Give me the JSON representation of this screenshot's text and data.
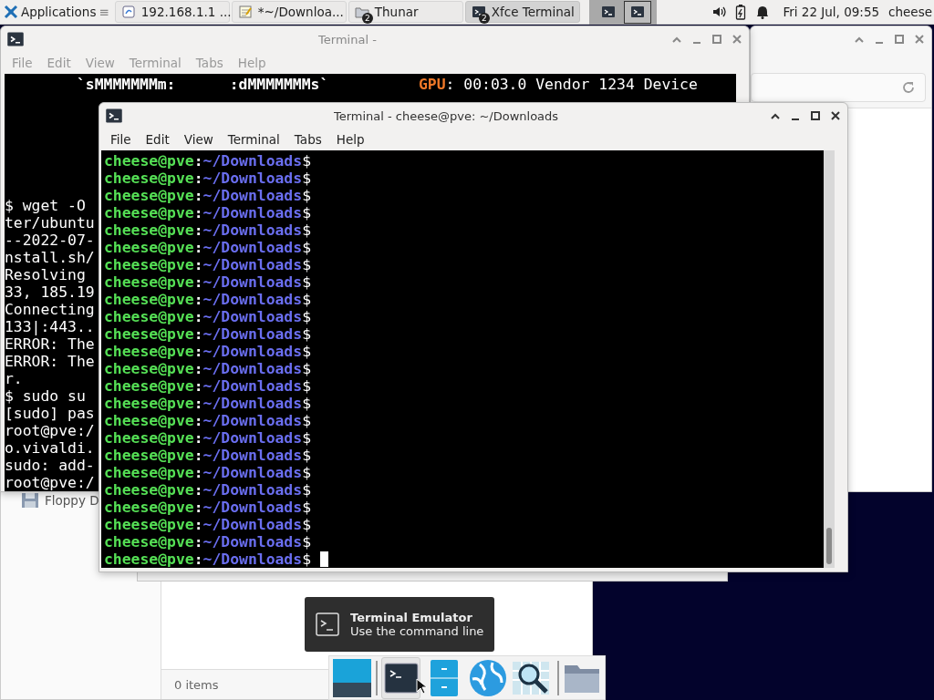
{
  "panel": {
    "apps_menu": "Applications",
    "apps_glyph": "≡",
    "tasks": [
      {
        "label": "192.168.1.1 ...",
        "kind": "browser",
        "selected": false
      },
      {
        "label": "*~/Downloa...",
        "kind": "editor",
        "selected": false
      },
      {
        "label": "Thunar",
        "kind": "files",
        "badge": "2",
        "selected": false
      },
      {
        "label": "Xfce Terminal",
        "kind": "terminal",
        "badge": "2",
        "selected": true
      }
    ],
    "workspaces": [
      {
        "selected": false
      },
      {
        "selected": true
      }
    ],
    "clock": "Fri 22 Jul, 09:55",
    "user": "cheese"
  },
  "back_terminal": {
    "title": "Terminal -",
    "menu": [
      "File",
      "Edit",
      "View",
      "Terminal",
      "Tabs",
      "Help"
    ],
    "info_lines": [
      {
        "art": "        `sMMMMMMMm:      :dMMMMMMMs`",
        "key": "GPU",
        "value": ": 00:03.0 Vendor 1234 Device"
      }
    ],
    "lines": [
      "$ wget -O",
      "ter/ubuntu",
      "--2022-07-",
      "nstall.sh/",
      "Resolving",
      "33, 185.19",
      "Connecting",
      "133|:443..",
      "ERROR: The",
      "ERROR: The",
      "r.",
      "$ sudo su",
      "[sudo] pas",
      "root@pve:/",
      "o.vivaldi.",
      "sudo: add-",
      "root@pve:/"
    ]
  },
  "file_manager": {
    "sidebar": [
      {
        "label": "Floppy D"
      }
    ],
    "status": "0 items"
  },
  "front_terminal": {
    "title": "Terminal - cheese@pve: ~/Downloads",
    "menu": [
      "File",
      "Edit",
      "View",
      "Terminal",
      "Tabs",
      "Help"
    ],
    "prompts": [
      {
        "user": "cheese@pve",
        "sep": ":",
        "path": "~/Downloads",
        "sign": "$",
        "cursor": false
      },
      {
        "user": "cheese@pve",
        "sep": ":",
        "path": "~/Downloads",
        "sign": "$",
        "cursor": false
      },
      {
        "user": "cheese@pve",
        "sep": ":",
        "path": "~/Downloads",
        "sign": "$",
        "cursor": false
      },
      {
        "user": "cheese@pve",
        "sep": ":",
        "path": "~/Downloads",
        "sign": "$",
        "cursor": false
      },
      {
        "user": "cheese@pve",
        "sep": ":",
        "path": "~/Downloads",
        "sign": "$",
        "cursor": false
      },
      {
        "user": "cheese@pve",
        "sep": ":",
        "path": "~/Downloads",
        "sign": "$",
        "cursor": false
      },
      {
        "user": "cheese@pve",
        "sep": ":",
        "path": "~/Downloads",
        "sign": "$",
        "cursor": false
      },
      {
        "user": "cheese@pve",
        "sep": ":",
        "path": "~/Downloads",
        "sign": "$",
        "cursor": false
      },
      {
        "user": "cheese@pve",
        "sep": ":",
        "path": "~/Downloads",
        "sign": "$",
        "cursor": false
      },
      {
        "user": "cheese@pve",
        "sep": ":",
        "path": "~/Downloads",
        "sign": "$",
        "cursor": false
      },
      {
        "user": "cheese@pve",
        "sep": ":",
        "path": "~/Downloads",
        "sign": "$",
        "cursor": false
      },
      {
        "user": "cheese@pve",
        "sep": ":",
        "path": "~/Downloads",
        "sign": "$",
        "cursor": false
      },
      {
        "user": "cheese@pve",
        "sep": ":",
        "path": "~/Downloads",
        "sign": "$",
        "cursor": false
      },
      {
        "user": "cheese@pve",
        "sep": ":",
        "path": "~/Downloads",
        "sign": "$",
        "cursor": false
      },
      {
        "user": "cheese@pve",
        "sep": ":",
        "path": "~/Downloads",
        "sign": "$",
        "cursor": false
      },
      {
        "user": "cheese@pve",
        "sep": ":",
        "path": "~/Downloads",
        "sign": "$",
        "cursor": false
      },
      {
        "user": "cheese@pve",
        "sep": ":",
        "path": "~/Downloads",
        "sign": "$",
        "cursor": false
      },
      {
        "user": "cheese@pve",
        "sep": ":",
        "path": "~/Downloads",
        "sign": "$",
        "cursor": false
      },
      {
        "user": "cheese@pve",
        "sep": ":",
        "path": "~/Downloads",
        "sign": "$",
        "cursor": false
      },
      {
        "user": "cheese@pve",
        "sep": ":",
        "path": "~/Downloads",
        "sign": "$",
        "cursor": false
      },
      {
        "user": "cheese@pve",
        "sep": ":",
        "path": "~/Downloads",
        "sign": "$",
        "cursor": false
      },
      {
        "user": "cheese@pve",
        "sep": ":",
        "path": "~/Downloads",
        "sign": "$",
        "cursor": false
      },
      {
        "user": "cheese@pve",
        "sep": ":",
        "path": "~/Downloads",
        "sign": "$",
        "cursor": false
      },
      {
        "user": "cheese@pve",
        "sep": ":",
        "path": "~/Downloads",
        "sign": "$",
        "cursor": true
      }
    ]
  },
  "tooltip": {
    "title": "Terminal Emulator",
    "subtitle": "Use the command line"
  },
  "dock": [
    {
      "kind": "desktop",
      "selected": false
    },
    {
      "kind": "separator"
    },
    {
      "kind": "terminal",
      "selected": true
    },
    {
      "kind": "cabinet",
      "selected": false
    },
    {
      "kind": "globe",
      "selected": false
    },
    {
      "kind": "search",
      "selected": false
    },
    {
      "kind": "separator"
    },
    {
      "kind": "folder",
      "selected": false
    }
  ]
}
